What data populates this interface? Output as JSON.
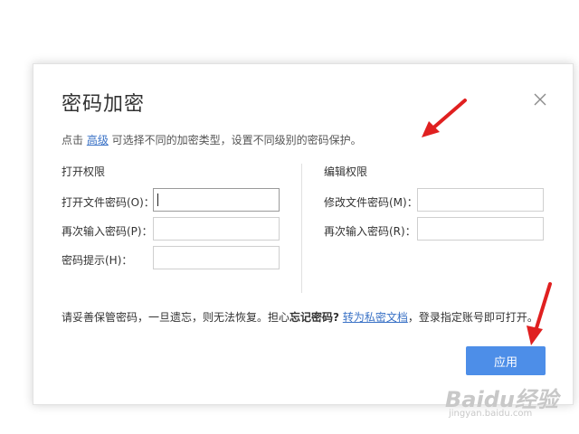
{
  "dialog": {
    "title": "密码加密",
    "hint_prefix": "点击 ",
    "hint_link": "高级",
    "hint_suffix": " 可选择不同的加密类型，设置不同级别的密码保护。"
  },
  "open_permission": {
    "section_title": "打开权限",
    "open_password_label": "打开文件密码(O)：",
    "open_password_value": "",
    "reenter_label": "再次输入密码(P)：",
    "reenter_value": "",
    "hint_label": "密码提示(H)：",
    "hint_value": ""
  },
  "edit_permission": {
    "section_title": "编辑权限",
    "modify_password_label": "修改文件密码(M)：",
    "modify_password_value": "",
    "reenter_label": "再次输入密码(R)：",
    "reenter_value": ""
  },
  "notice": {
    "text_a": "请妥善保管密码，一旦遗忘，则无法恢复。担心",
    "text_bold": "忘记密码?",
    "text_b": " ",
    "link": "转为私密文档",
    "text_c": "，登录指定账号即可打开。"
  },
  "apply_label": "应用",
  "watermark": {
    "brand": "Baidu经验",
    "url": "jingyan.baidu.com"
  },
  "colors": {
    "accent": "#4d8ee8",
    "link": "#3a72c6",
    "annotation_arrow": "#e02020"
  },
  "icons": {
    "close": "close-icon",
    "annotation": "red-arrow-icon"
  }
}
